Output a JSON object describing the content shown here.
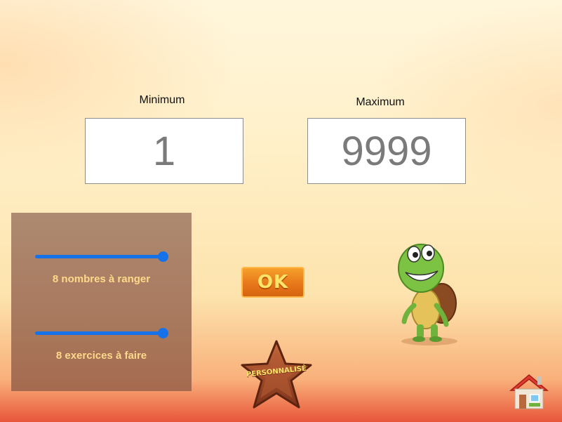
{
  "range": {
    "min_label": "Minimum",
    "min_value": "1",
    "max_label": "Maximum",
    "max_value": "9999"
  },
  "settings": {
    "numbers_slider": {
      "value": 8,
      "caption": "8 nombres à ranger"
    },
    "exercises_slider": {
      "value": 8,
      "caption": "8 exercices à faire"
    }
  },
  "buttons": {
    "ok_label": "OK",
    "customize_label": "PERSONNALISÉ"
  },
  "icons": {
    "mascot": "turtle-mascot-icon",
    "home": "home-icon"
  },
  "colors": {
    "slider_blue": "#1572e8",
    "caption_yellow": "#ffd98a",
    "ok_orange": "#e7781a"
  }
}
